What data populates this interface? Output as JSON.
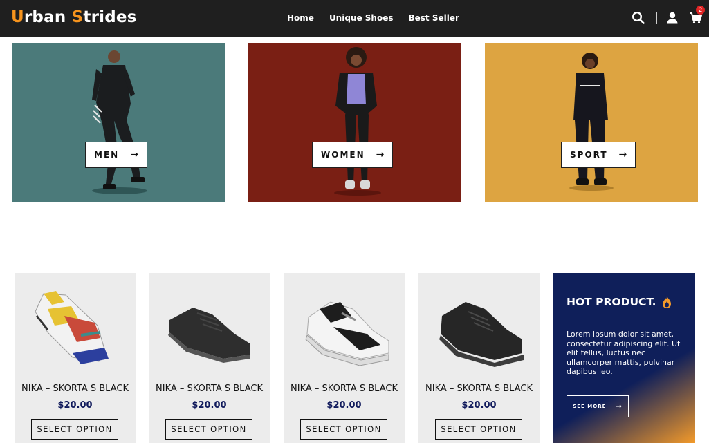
{
  "brand": {
    "first_letter": "U",
    "first_rest": "rban ",
    "second_letter": "S",
    "second_rest": "trides",
    "accent": "#f7941d"
  },
  "nav": {
    "items": [
      "Home",
      "Unique Shoes",
      "Best Seller"
    ]
  },
  "header_icons": {
    "search": "search-icon",
    "user": "user-icon",
    "cart": "cart-icon",
    "cart_count": "2"
  },
  "categories": [
    {
      "label": "MEN",
      "bg": "#4b7a7a"
    },
    {
      "label": "WOMEN",
      "bg": "#7a1f14"
    },
    {
      "label": "SPORT",
      "bg": "#dda441"
    }
  ],
  "arrow_glyph": "→",
  "products": [
    {
      "name": "NIKA – SKORTA S BLACK",
      "price": "$20.00",
      "button": "SELECT OPTION"
    },
    {
      "name": "NIKA – SKORTA S BLACK",
      "price": "$20.00",
      "button": "SELECT OPTION"
    },
    {
      "name": "NIKA – SKORTA S BLACK",
      "price": "$20.00",
      "button": "SELECT OPTION"
    },
    {
      "name": "NIKA – SKORTA S BLACK",
      "price": "$20.00",
      "button": "SELECT OPTION"
    }
  ],
  "hot": {
    "title": "HOT PRODUCT.",
    "text": "Lorem ipsum dolor sit amet, consectetur adipiscing elit. Ut elit tellus, luctus nec ullamcorper mattis, pulvinar dapibus leo.",
    "button": "SEE MORE",
    "bg": "#0f1f5a",
    "accent": "#f39a2a"
  },
  "colors": {
    "header_bg": "#1f1f1f",
    "price": "#101a5c",
    "badge": "#e02424"
  }
}
